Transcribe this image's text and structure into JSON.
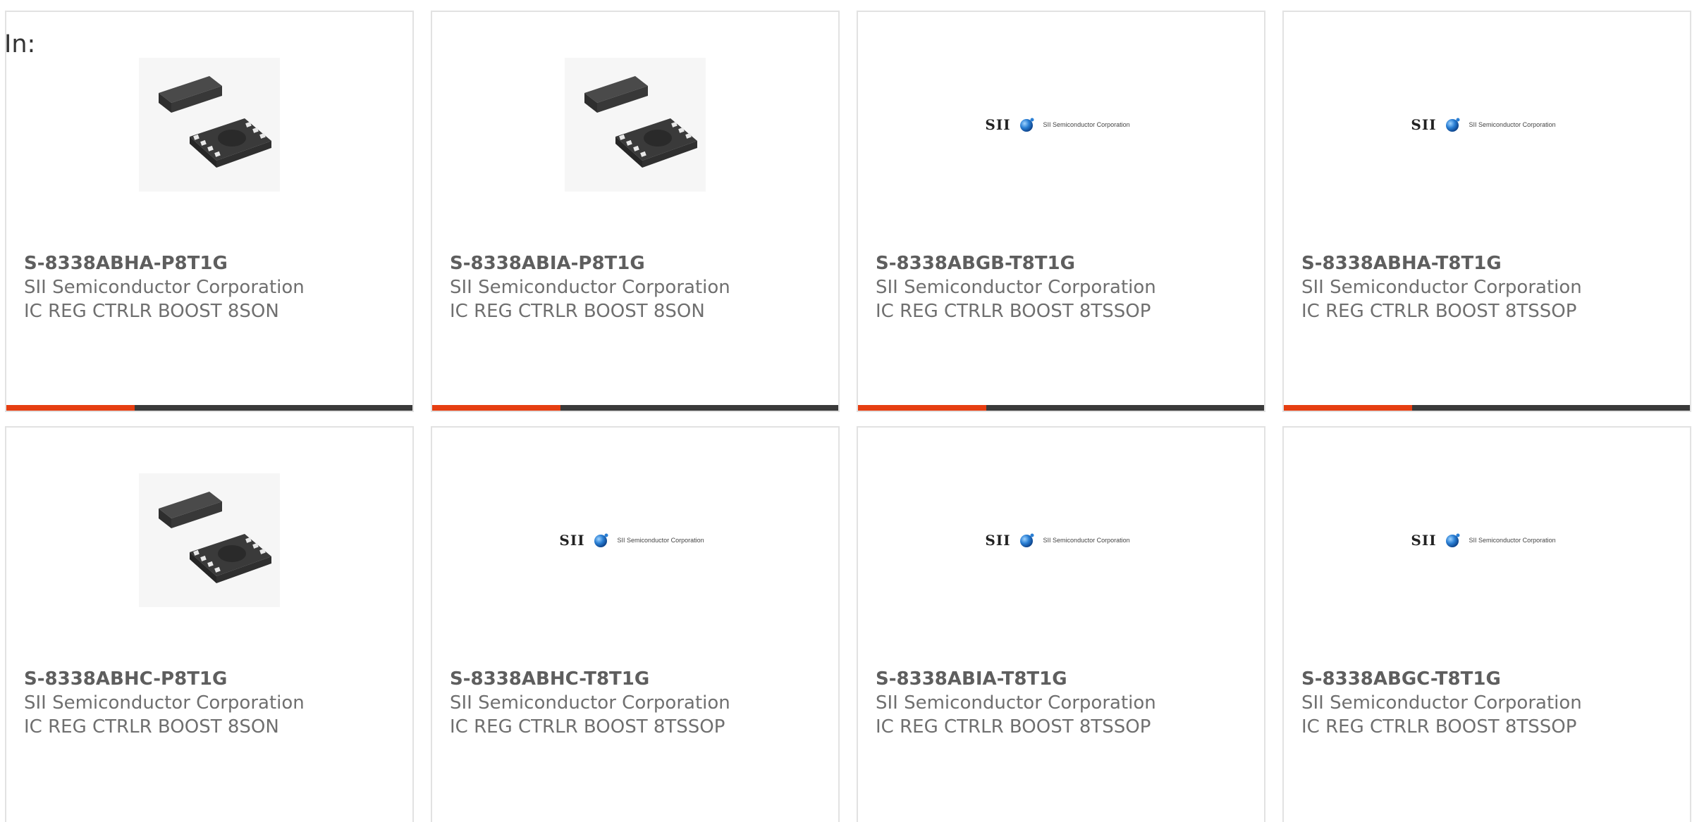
{
  "header": {
    "label": "In:"
  },
  "logo": {
    "brand": "SII",
    "tagline": "SII Semiconductor Corporation"
  },
  "colors": {
    "accent": "#e63e11",
    "bar": "#3a3a3a",
    "border": "#e2e2e2",
    "text": "#6f6f6f"
  },
  "products": [
    {
      "part_number": "S-8338ABHA-P8T1G",
      "manufacturer": "SII Semiconductor Corporation",
      "description": "IC REG CTRLR BOOST 8SON",
      "image": "package-8son",
      "has_accent_bar": true
    },
    {
      "part_number": "S-8338ABIA-P8T1G",
      "manufacturer": "SII Semiconductor Corporation",
      "description": "IC REG CTRLR BOOST 8SON",
      "image": "package-8son",
      "has_accent_bar": true
    },
    {
      "part_number": "S-8338ABGB-T8T1G",
      "manufacturer": "SII Semiconductor Corporation",
      "description": "IC REG CTRLR BOOST 8TSSOP",
      "image": "sii-logo",
      "has_accent_bar": true
    },
    {
      "part_number": "S-8338ABHA-T8T1G",
      "manufacturer": "SII Semiconductor Corporation",
      "description": "IC REG CTRLR BOOST 8TSSOP",
      "image": "sii-logo",
      "has_accent_bar": true
    },
    {
      "part_number": "S-8338ABHC-P8T1G",
      "manufacturer": "SII Semiconductor Corporation",
      "description": "IC REG CTRLR BOOST 8SON",
      "image": "package-8son",
      "has_accent_bar": false
    },
    {
      "part_number": "S-8338ABHC-T8T1G",
      "manufacturer": "SII Semiconductor Corporation",
      "description": "IC REG CTRLR BOOST 8TSSOP",
      "image": "sii-logo",
      "has_accent_bar": false
    },
    {
      "part_number": "S-8338ABIA-T8T1G",
      "manufacturer": "SII Semiconductor Corporation",
      "description": "IC REG CTRLR BOOST 8TSSOP",
      "image": "sii-logo",
      "has_accent_bar": false
    },
    {
      "part_number": "S-8338ABGC-T8T1G",
      "manufacturer": "SII Semiconductor Corporation",
      "description": "IC REG CTRLR BOOST 8TSSOP",
      "image": "sii-logo",
      "has_accent_bar": false
    }
  ]
}
